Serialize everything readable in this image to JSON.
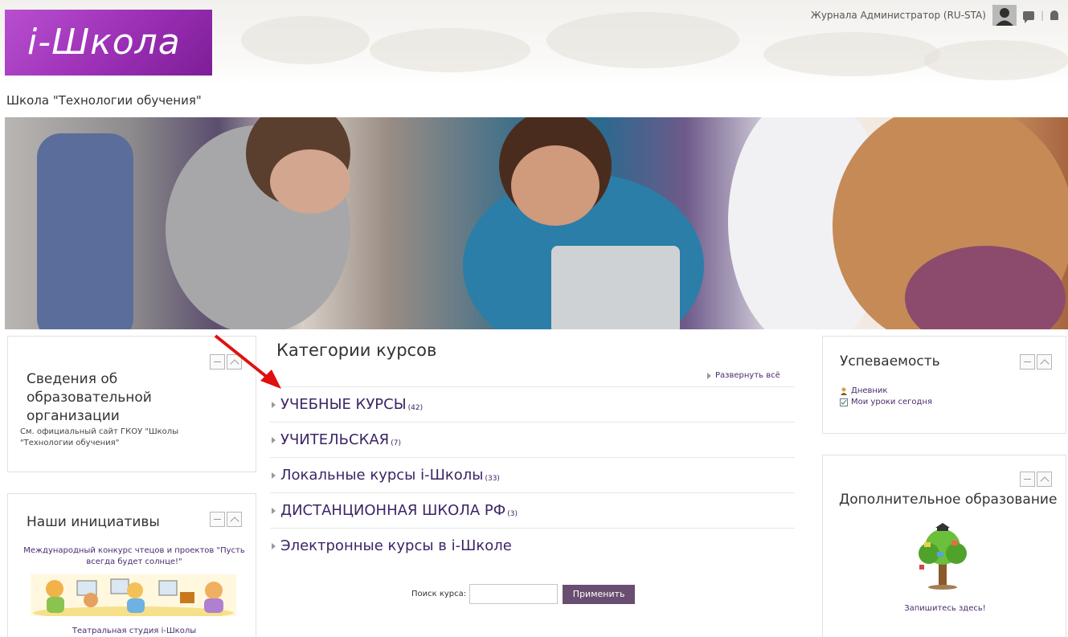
{
  "header": {
    "logo_text": "i-Школа",
    "user_name": "Журнала Администратор (RU-STA)",
    "separator": "|"
  },
  "site": {
    "school_name": "Школа \"Технологии обучения\""
  },
  "blocks_left": [
    {
      "title": "Сведения об образовательной организации",
      "text": "См. официальный сайт ГКОУ \"Школы \"Технологии обучения\""
    },
    {
      "title": "Наши инициативы",
      "text": "Международный конкурс чтецов и проектов \"Пусть всегда будет солнце!\"",
      "footer": "Театральная студия i-Школы"
    }
  ],
  "main": {
    "title": "Категории курсов",
    "expand_all": "Развернуть всё",
    "categories": [
      {
        "name": "УЧЕБНЫЕ КУРСЫ",
        "count": "(42)"
      },
      {
        "name": "УЧИТЕЛЬСКАЯ",
        "count": "(7)"
      },
      {
        "name": "Локальные курсы i-Школы",
        "count": "(33)"
      },
      {
        "name": "ДИСТАНЦИОННАЯ ШКОЛА РФ",
        "count": "(3)"
      },
      {
        "name": "Электронные курсы в i-Школе",
        "count": ""
      }
    ],
    "search": {
      "label": "Поиск курса:",
      "value": "",
      "button": "Применить"
    }
  },
  "blocks_right": [
    {
      "title": "Успеваемость",
      "items": [
        "Дневник",
        "Мои уроки сегодня"
      ]
    },
    {
      "title": "Дополнительное образование",
      "footer": "Запишитесь здесь!"
    }
  ],
  "colors": {
    "logo_purple": "#9b2fb5",
    "link_purple": "#3d2466",
    "button_bg": "#6a4e72",
    "annotation_arrow": "#e01010"
  }
}
